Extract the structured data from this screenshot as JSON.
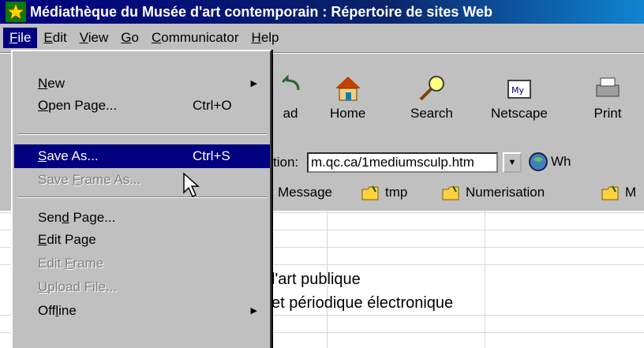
{
  "window": {
    "title": "Médiathèque du Musée d'art contemporain : Répertoire de sites Web"
  },
  "menubar": {
    "items": [
      {
        "label": "File",
        "mnemonic": "F"
      },
      {
        "label": "Edit",
        "mnemonic": "E"
      },
      {
        "label": "View",
        "mnemonic": "V"
      },
      {
        "label": "Go",
        "mnemonic": "G"
      },
      {
        "label": "Communicator",
        "mnemonic": "C"
      },
      {
        "label": "Help",
        "mnemonic": "H"
      }
    ]
  },
  "file_menu": {
    "items": [
      {
        "label_pre": "",
        "mn": "N",
        "label_post": "ew",
        "shortcut": "",
        "submenu": true,
        "state": "normal"
      },
      {
        "label_pre": "",
        "mn": "O",
        "label_post": "pen Page...",
        "shortcut": "Ctrl+O",
        "submenu": false,
        "state": "normal"
      },
      {
        "label_pre": "",
        "mn": "S",
        "label_post": "ave As...",
        "shortcut": "Ctrl+S",
        "submenu": false,
        "state": "selected"
      },
      {
        "label_pre": "Save ",
        "mn": "F",
        "label_post": "rame As...",
        "shortcut": "",
        "submenu": false,
        "state": "disabled"
      },
      {
        "label_pre": "Sen",
        "mn": "d",
        "label_post": " Page...",
        "shortcut": "",
        "submenu": false,
        "state": "normal"
      },
      {
        "label_pre": "",
        "mn": "E",
        "label_post": "dit Page",
        "shortcut": "",
        "submenu": false,
        "state": "normal"
      },
      {
        "label_pre": "Edit ",
        "mn": "F",
        "label_post": "rame",
        "shortcut": "",
        "submenu": false,
        "state": "disabled"
      },
      {
        "label_pre": "",
        "mn": "U",
        "label_post": "pload File...",
        "shortcut": "",
        "submenu": false,
        "state": "disabled"
      },
      {
        "label_pre": "Off",
        "mn": "l",
        "label_post": "ine",
        "shortcut": "",
        "submenu": true,
        "state": "normal"
      }
    ],
    "submenu_arrow": "▶"
  },
  "toolbar": {
    "buttons": [
      {
        "label": "ad",
        "icon": "reload-icon"
      },
      {
        "label": "Home",
        "icon": "home-icon"
      },
      {
        "label": "Search",
        "icon": "search-icon"
      },
      {
        "label": "Netscape",
        "icon": "netscape-icon"
      },
      {
        "label": "Print",
        "icon": "print-icon"
      }
    ]
  },
  "location": {
    "label": "tion:",
    "value": "m.qc.ca/1mediumsculp.htm",
    "dropdown_icon": "▼",
    "whats_related": "Wh"
  },
  "bookmarks": {
    "items": [
      {
        "label": "Message"
      },
      {
        "label": "tmp"
      },
      {
        "label": "Numerisation"
      },
      {
        "label": "M"
      }
    ]
  },
  "content": {
    "line1": "l'art publique",
    "line2": "et périodique électronique"
  },
  "colors": {
    "titlebar": "#000080",
    "selection": "#000080",
    "chrome": "#c0c0c0"
  }
}
